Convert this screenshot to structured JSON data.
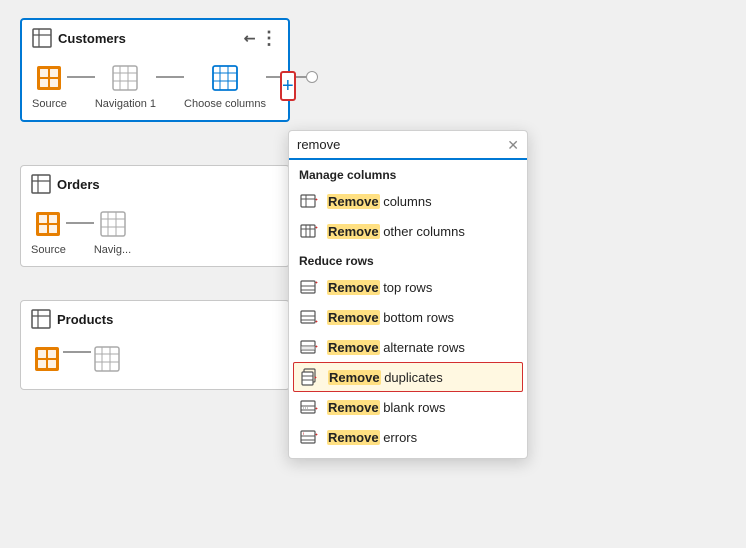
{
  "cards": [
    {
      "id": "customers",
      "title": "Customers",
      "active": true,
      "steps": [
        {
          "label": "Source",
          "type": "orange"
        },
        {
          "label": "Navigation 1",
          "type": "grid"
        },
        {
          "label": "Choose columns",
          "type": "grid-blue",
          "isLast": true
        }
      ]
    },
    {
      "id": "orders",
      "title": "Orders",
      "active": false,
      "steps": [
        {
          "label": "Source",
          "type": "orange"
        },
        {
          "label": "Navig...",
          "type": "grid"
        }
      ]
    },
    {
      "id": "products",
      "title": "Products",
      "active": false,
      "steps": [
        {
          "label": "",
          "type": "orange"
        },
        {
          "label": "",
          "type": "grid"
        }
      ]
    }
  ],
  "dropdown": {
    "search_placeholder": "remove",
    "sections": [
      {
        "header": "Manage columns",
        "items": [
          {
            "label_prefix": "",
            "highlight": "Remove",
            "label_suffix": " columns",
            "icon": "remove-columns"
          },
          {
            "label_prefix": "",
            "highlight": "Remove",
            "label_suffix": " other columns",
            "icon": "remove-other-columns"
          }
        ]
      },
      {
        "header": "Reduce rows",
        "items": [
          {
            "label_prefix": "",
            "highlight": "Remove",
            "label_suffix": " top rows",
            "icon": "remove-top-rows"
          },
          {
            "label_prefix": "",
            "highlight": "Remove",
            "label_suffix": " bottom rows",
            "icon": "remove-bottom-rows"
          },
          {
            "label_prefix": "",
            "highlight": "Remove",
            "label_suffix": " alternate rows",
            "icon": "remove-alternate-rows"
          },
          {
            "label_prefix": "",
            "highlight": "Remove",
            "label_suffix": " duplicates",
            "icon": "remove-duplicates",
            "highlighted": true
          },
          {
            "label_prefix": "",
            "highlight": "Remove",
            "label_suffix": " blank rows",
            "icon": "remove-blank-rows"
          },
          {
            "label_prefix": "",
            "highlight": "Remove",
            "label_suffix": " errors",
            "icon": "remove-errors"
          }
        ]
      }
    ]
  },
  "colors": {
    "accent_blue": "#0078d4",
    "accent_red": "#d32f2f",
    "orange": "#e67e00",
    "highlight_yellow": "#ffe082"
  }
}
